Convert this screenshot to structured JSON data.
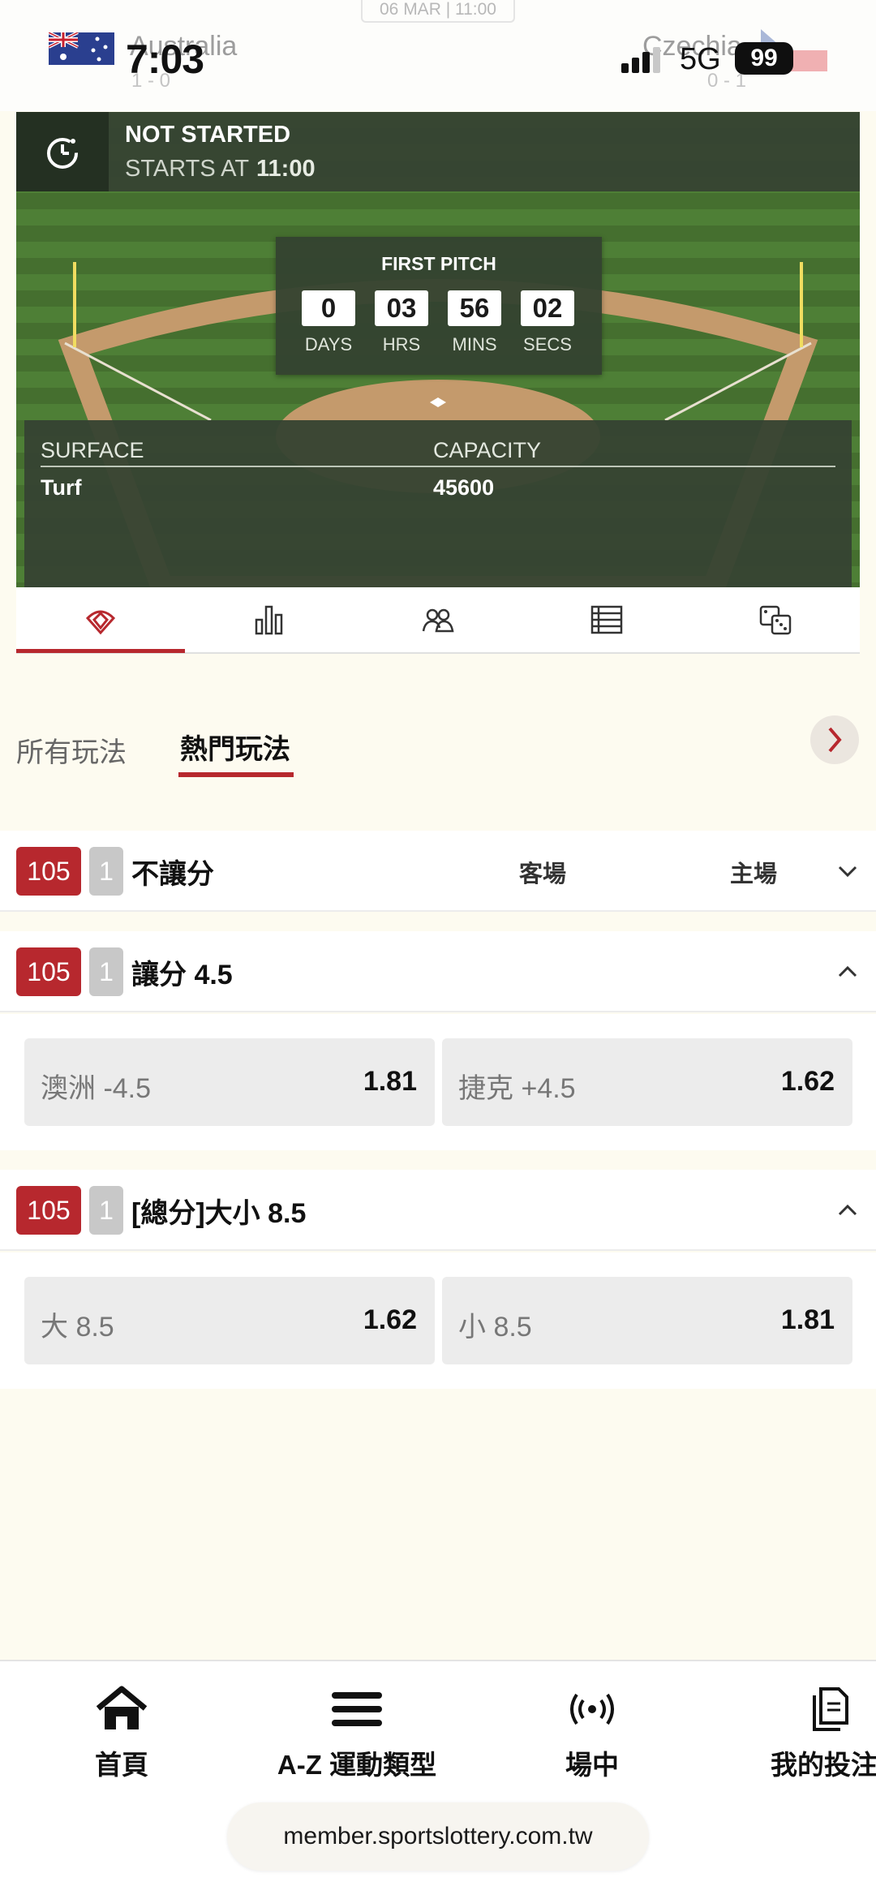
{
  "header": {
    "match_date": "06 MAR | 11:00",
    "home_team": "Australia",
    "home_score": "1 - 0",
    "away_team": "Czechia",
    "away_score": "0 - 1"
  },
  "status_bar": {
    "time": "7:03",
    "network": "5G",
    "battery": "99"
  },
  "match_status": {
    "title": "NOT STARTED",
    "starts_label": "STARTS AT",
    "starts_time": "11:00"
  },
  "countdown": {
    "title": "FIRST PITCH",
    "units": [
      {
        "value": "0",
        "label": "DAYS"
      },
      {
        "value": "03",
        "label": "HRS"
      },
      {
        "value": "56",
        "label": "MINS"
      },
      {
        "value": "02",
        "label": "SECS"
      }
    ]
  },
  "venue": {
    "surface_label": "SURFACE",
    "surface_value": "Turf",
    "capacity_label": "CAPACITY",
    "capacity_value": "45600"
  },
  "icon_tabs": [
    "field-icon",
    "stats-icon",
    "lineup-icon",
    "standings-icon",
    "odds-icon"
  ],
  "market_tabs": {
    "all": "所有玩法",
    "hot": "熱門玩法"
  },
  "markets": [
    {
      "code": "105",
      "num": "1",
      "name": "不讓分",
      "col_away": "客場",
      "col_home": "主場"
    },
    {
      "code": "105",
      "num": "1",
      "name": "讓分 4.5",
      "odds": [
        {
          "label": "澳洲 -4.5",
          "value": "1.81"
        },
        {
          "label": "捷克 +4.5",
          "value": "1.62"
        }
      ]
    },
    {
      "code": "105",
      "num": "1",
      "name": "[總分]大小 8.5",
      "odds": [
        {
          "label": "大 8.5",
          "value": "1.62"
        },
        {
          "label": "小 8.5",
          "value": "1.81"
        }
      ]
    }
  ],
  "bottom_nav": [
    {
      "label": "首頁",
      "icon": "home-icon"
    },
    {
      "label": "A-Z 運動類型",
      "icon": "menu-icon"
    },
    {
      "label": "場中",
      "icon": "live-icon"
    },
    {
      "label": "我的投注",
      "icon": "bets-icon"
    }
  ],
  "url": "member.sportslottery.com.tw",
  "colors": {
    "accent": "#b7282e",
    "panel": "#364432",
    "field": "#4a7a32"
  }
}
